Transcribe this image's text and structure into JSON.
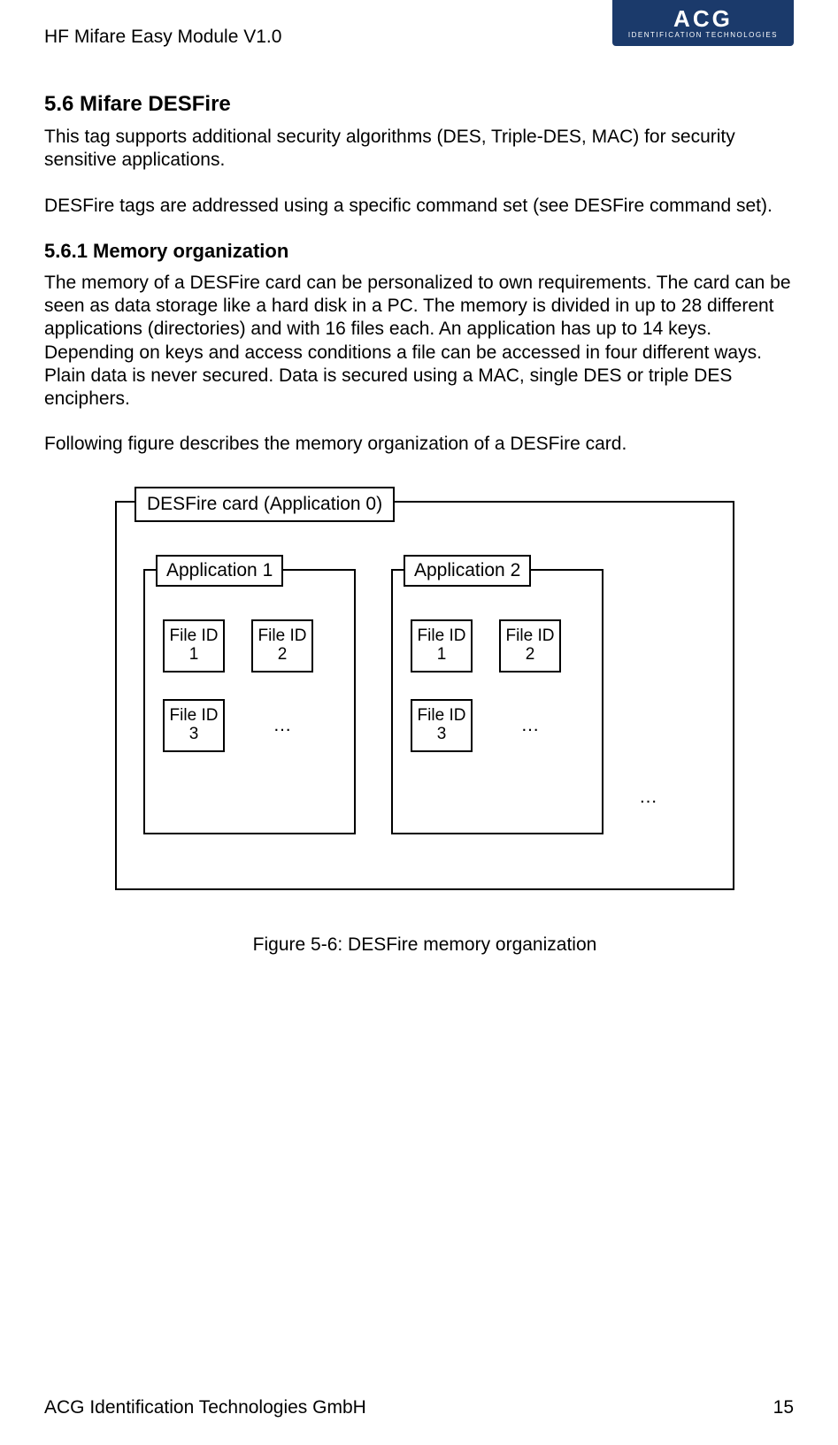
{
  "header": {
    "doc_title": "HF Mifare Easy Module V1.0",
    "logo_main": "ACG",
    "logo_sub": "IDENTIFICATION TECHNOLOGIES"
  },
  "section": {
    "heading": "5.6 Mifare DESFire",
    "para1": "This tag supports additional security algorithms (DES, Triple-DES, MAC) for security sensitive applications.",
    "para2": "DESFire tags are addressed using a specific command set (see DESFire command set).",
    "sub_heading": "5.6.1   Memory organization",
    "para3": "The memory of a DESFire card can be personalized to own requirements. The card can be seen as data storage like a hard disk in a PC. The memory is divided in up to 28 different applications (directories) and with 16 files each. An application has up to 14 keys. Depending on keys and access conditions a file can be accessed in four different ways. Plain data is never secured. Data is secured using a MAC, single DES or triple DES enciphers.",
    "para4": "Following figure describes the memory organization of a DESFire card."
  },
  "figure": {
    "card_label": "DESFire card (Application 0)",
    "app1_label": "Application 1",
    "app2_label": "Application 2",
    "file1": "File ID 1",
    "file2": "File ID 2",
    "file3": "File ID 3",
    "ellipsis": "…",
    "caption": "Figure 5-6: DESFire memory organization"
  },
  "footer": {
    "company": "ACG Identification Technologies GmbH",
    "page_num": "15"
  }
}
